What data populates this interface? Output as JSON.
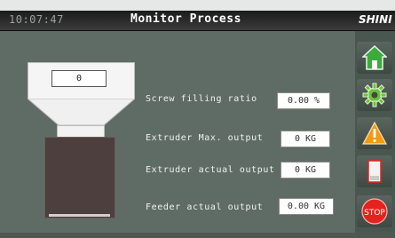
{
  "header": {
    "time": "10:07:47",
    "title": "Monitor Process",
    "brand": "SHINI"
  },
  "hopper": {
    "level_value": "0"
  },
  "readings": [
    {
      "label": "Screw filling ratio",
      "value": "0.00 %"
    },
    {
      "label": "Extruder Max. output",
      "value": "0 KG"
    },
    {
      "label": "Extruder actual output",
      "value": "0 KG"
    },
    {
      "label": "Feeder actual output",
      "value": "0.00 KG"
    }
  ],
  "side_buttons": [
    {
      "icon": "home-icon"
    },
    {
      "icon": "gear-icon"
    },
    {
      "icon": "warning-icon"
    },
    {
      "icon": "hopper-icon"
    },
    {
      "icon": "stop-icon",
      "label": "STOP"
    }
  ],
  "colors": {
    "background": "#5f6c66",
    "home": "#3cab3c",
    "gear": "#6ec13a",
    "warning": "#f29a16",
    "stop": "#e3231e"
  }
}
